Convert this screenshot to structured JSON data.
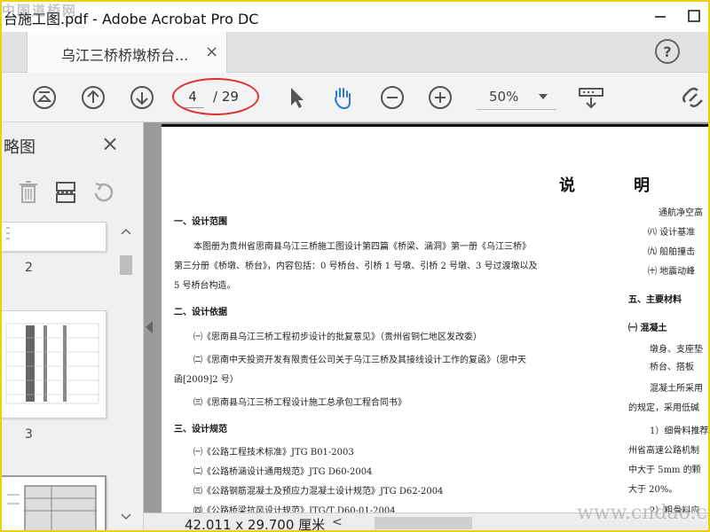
{
  "window": {
    "title": "台施工图.pdf - Adobe Acrobat Pro DC",
    "watermark_top": "中国道桥网",
    "watermark_bottom": "www.cndao.com"
  },
  "tab": {
    "label": "乌江三桥桥墩桥台...",
    "close": "×"
  },
  "help": {
    "label": "?"
  },
  "toolbar": {
    "current_page": "4",
    "total_pages": "/ 29",
    "zoom": "50%"
  },
  "sidebar": {
    "title": "略图",
    "close": "×",
    "thumbnails": [
      {
        "page": "2"
      },
      {
        "page": "3"
      }
    ]
  },
  "document": {
    "heading_left": "说",
    "heading_right": "明",
    "left_col": [
      {
        "kind": "sec",
        "text": "一、设计范围"
      },
      {
        "kind": "ln",
        "text": "本图册为贵州省思南县乌江三桥施工图设计第四篇《桥梁、涵洞》第一册《乌江三桥》"
      },
      {
        "kind": "ln",
        "text": "第三分册《桥墩、桥台》，内容包括：0 号桥台、引桥 1 号墩、引桥 2 号墩、3 号过渡墩以及"
      },
      {
        "kind": "ln",
        "text": "5 号桥台构造。"
      },
      {
        "kind": "sec",
        "text": "二、设计依据"
      },
      {
        "kind": "ln",
        "text": "㈠《思南县乌江三桥工程初步设计的批复意见》（贵州省铜仁地区发改委）"
      },
      {
        "kind": "ln",
        "text": "㈡《思南中天投资开发有限责任公司关于乌江三桥及其接线设计工作的复函》（思中天"
      },
      {
        "kind": "ln",
        "text": "函[2009]2 号）"
      },
      {
        "kind": "ln",
        "text": "㈢《思南县乌江三桥工程设计施工总承包工程合同书》"
      },
      {
        "kind": "sec",
        "text": "三、设计规范"
      },
      {
        "kind": "ln",
        "text": "㈠《公路工程技术标准》JTG B01-2003"
      },
      {
        "kind": "ln",
        "text": "㈡《公路桥涵设计通用规范》JTG D60-2004"
      },
      {
        "kind": "ln",
        "text": "㈢《公路钢筋混凝土及预应力混凝土设计规范》JTG D62-2004"
      },
      {
        "kind": "ln",
        "text": "㈣《公路桥梁抗风设计规范》JTG/T D60-01-2004"
      }
    ],
    "right_col": [
      {
        "kind": "ln",
        "text": "通航净空高"
      },
      {
        "kind": "ln",
        "text": "㈧ 设计基准"
      },
      {
        "kind": "ln",
        "text": "㈨ 船舶撞击"
      },
      {
        "kind": "ln",
        "text": "㈩ 地震动峰"
      },
      {
        "kind": "sec",
        "text": "五、主要材料"
      },
      {
        "kind": "sec",
        "text": "㈠ 混凝土"
      },
      {
        "kind": "ln",
        "text": "墩身、支座垫"
      },
      {
        "kind": "ln",
        "text": "桥台、搭板"
      },
      {
        "kind": "ln",
        "text": "混凝土所采用"
      },
      {
        "kind": "ln",
        "text": "的规定，采用低碱"
      },
      {
        "kind": "ln",
        "text": "1）细骨料推荐"
      },
      {
        "kind": "ln",
        "text": "州省高速公路机制"
      },
      {
        "kind": "ln",
        "text": "中大于 5mm 的颗"
      },
      {
        "kind": "ln",
        "text": "大于 20%。"
      },
      {
        "kind": "ln",
        "text": "2）粗骨料应"
      }
    ]
  },
  "status": {
    "dimensions": "42.011 x 29.700 厘米",
    "scroll_left": "<"
  }
}
